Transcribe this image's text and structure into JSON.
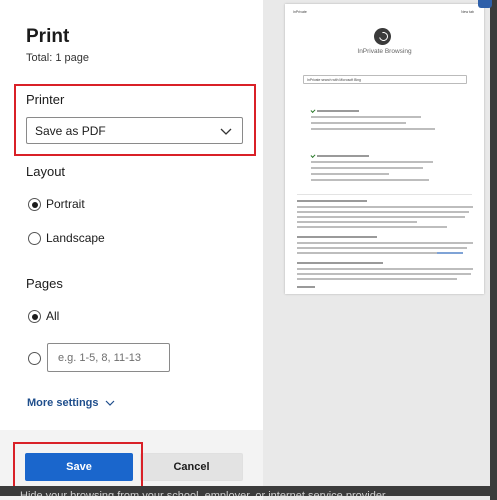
{
  "dialog": {
    "title": "Print",
    "total": "Total: 1 page"
  },
  "printer": {
    "label": "Printer",
    "selected": "Save as PDF"
  },
  "layout": {
    "label": "Layout",
    "options": [
      {
        "label": "Portrait",
        "checked": true
      },
      {
        "label": "Landscape",
        "checked": false
      }
    ]
  },
  "pages": {
    "label": "Pages",
    "all_label": "All",
    "custom_placeholder": "e.g. 1-5, 8, 11-13"
  },
  "more_settings": "More settings",
  "buttons": {
    "save": "Save",
    "cancel": "Cancel"
  },
  "preview": {
    "page_header_left": "InPrivate",
    "page_header_right": "New tab",
    "heading": "InPrivate Browsing",
    "search_box": "InPrivate search with Microsoft Bing",
    "footer_link": "Read more"
  },
  "background_text": "Hide your browsing from your school, employer, or internet service provider",
  "colors": {
    "accent": "#1a66cc",
    "highlight": "#d92027",
    "link": "#1f4e8c"
  }
}
